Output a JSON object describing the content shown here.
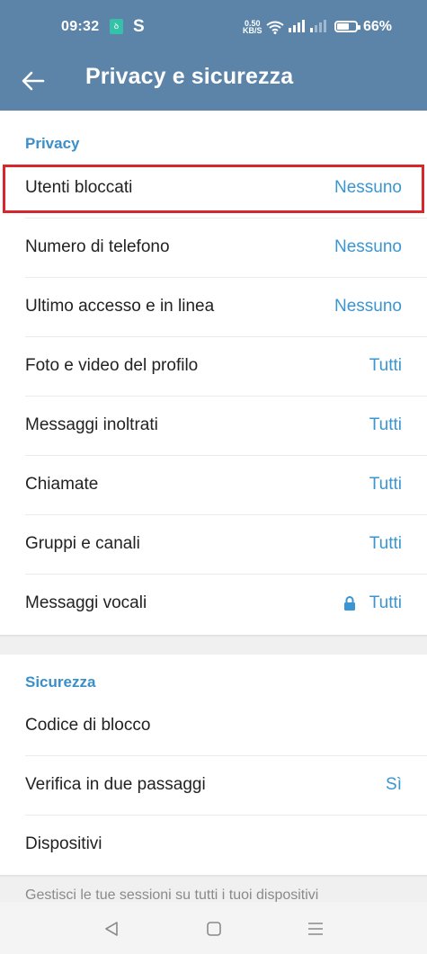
{
  "status_bar": {
    "time": "09:32",
    "app_icon_1_glyph": "ꝺ",
    "app_icon_2_glyph": "S",
    "net_speed_value": "0.50",
    "net_speed_unit": "KB/S",
    "battery_percent": "66%",
    "battery_level": 0.66
  },
  "app_bar": {
    "title": "Privacy e sicurezza",
    "background": "#5b84a8"
  },
  "privacy": {
    "header": "Privacy",
    "items": [
      {
        "label": "Utenti bloccati",
        "value": "Nessuno"
      },
      {
        "label": "Numero di telefono",
        "value": "Nessuno"
      },
      {
        "label": "Ultimo accesso e in linea",
        "value": "Nessuno"
      },
      {
        "label": "Foto e video del profilo",
        "value": "Tutti"
      },
      {
        "label": "Messaggi inoltrati",
        "value": "Tutti"
      },
      {
        "label": "Chiamate",
        "value": "Tutti"
      },
      {
        "label": "Gruppi e canali",
        "value": "Tutti"
      },
      {
        "label": "Messaggi vocali",
        "value": "Tutti",
        "icon": "lock-icon"
      }
    ]
  },
  "security": {
    "header": "Sicurezza",
    "items": [
      {
        "label": "Codice di blocco",
        "value": ""
      },
      {
        "label": "Verifica in due passaggi",
        "value": "Sì"
      },
      {
        "label": "Dispositivi",
        "value": ""
      }
    ],
    "footer_note": "Gestisci le tue sessioni su tutti i tuoi dispositivi"
  },
  "colors": {
    "accent": "#3a95d1",
    "highlight_border": "#d8262d"
  },
  "nav_bar": {
    "icons": [
      "back-triangle-icon",
      "home-square-icon",
      "recents-menu-icon"
    ]
  }
}
